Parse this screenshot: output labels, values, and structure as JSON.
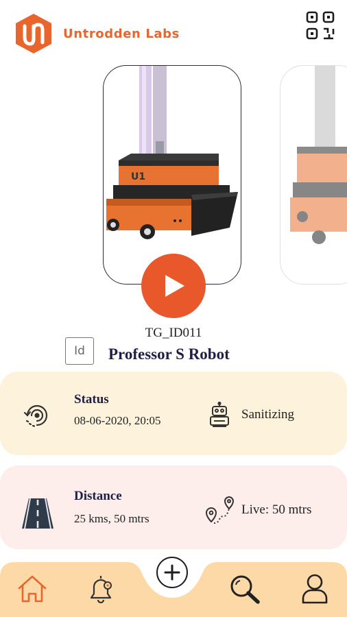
{
  "header": {
    "brand_name": "Untrodden Labs",
    "logo_icon": "untrodden-labs-logo",
    "qr_icon": "qr-code-icon"
  },
  "robot": {
    "code": "TG_ID011",
    "name": "Professor S Robot",
    "id_badge": "Id"
  },
  "status_panel": {
    "title": "Status",
    "timestamp": "08-06-2020, 20:05",
    "state": "Sanitizing",
    "left_icon": "history-icon",
    "right_icon": "robot-icon"
  },
  "distance_panel": {
    "title": "Distance",
    "value": "25 kms, 50 mtrs",
    "live": "Live: 50 mtrs",
    "left_icon": "road-icon",
    "right_icon": "route-pin-icon"
  },
  "nav": {
    "items": [
      "home-icon",
      "bell-icon",
      "add-icon",
      "search-icon",
      "user-icon"
    ]
  },
  "colors": {
    "brand": "#e8662e",
    "play": "#e9582a",
    "status_bg": "#fdf3dc",
    "distance_bg": "#fdeeeb",
    "nav_bg": "#fcd9a6",
    "title_navy": "#1d1f44"
  }
}
